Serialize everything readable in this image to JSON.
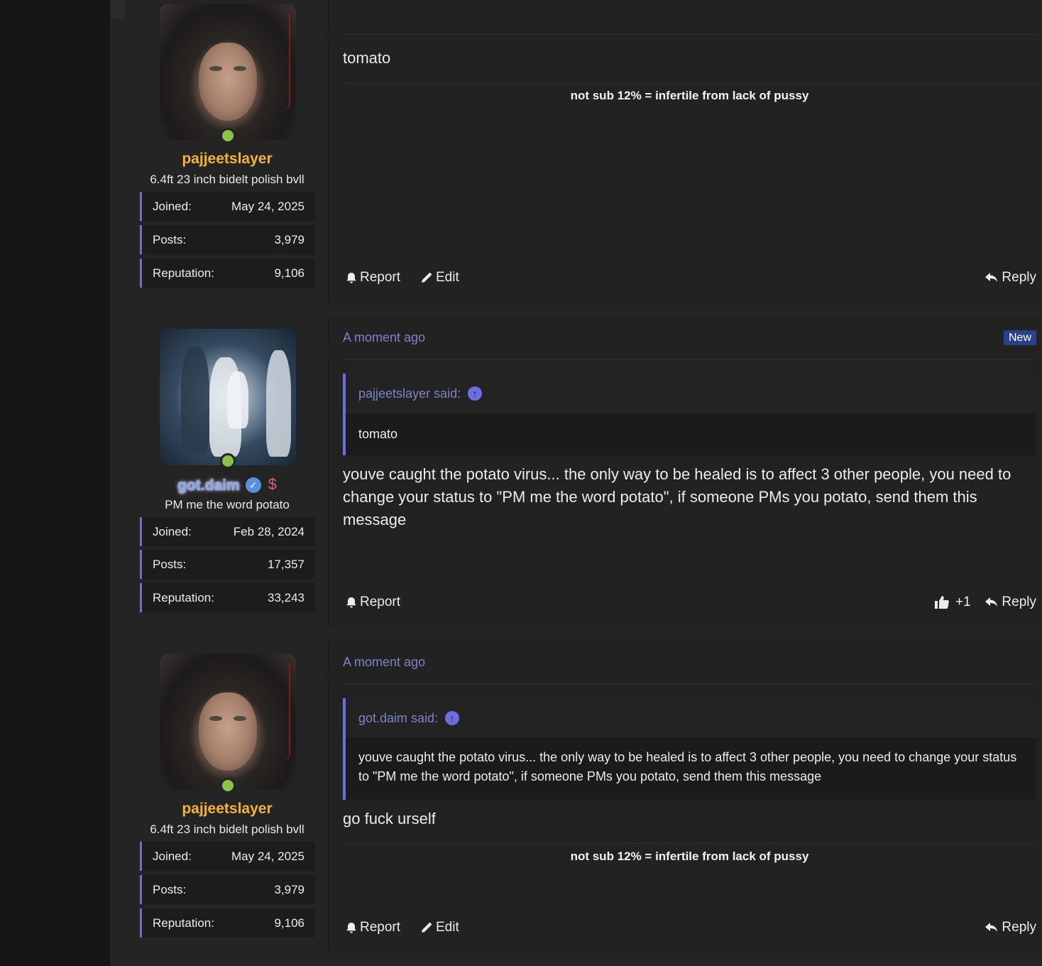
{
  "posts": [
    {
      "username": "pajjeetslayer",
      "user_title": "6.4ft 23 inch bidelt polish bvll",
      "stats": [
        {
          "label": "Joined:",
          "value": "May 24, 2025"
        },
        {
          "label": "Posts:",
          "value": "3,979"
        },
        {
          "label": "Reputation:",
          "value": "9,106"
        }
      ],
      "message": "tomato",
      "signature": "not sub 12% = infertile from lack of pussy",
      "actions": {
        "report": "Report",
        "edit": "Edit",
        "reply": "Reply"
      }
    },
    {
      "username": "got.daim",
      "user_title": "PM me the word potato",
      "stats": [
        {
          "label": "Joined:",
          "value": "Feb 28, 2024"
        },
        {
          "label": "Posts:",
          "value": "17,357"
        },
        {
          "label": "Reputation:",
          "value": "33,243"
        }
      ],
      "timestamp": "A moment ago",
      "badge": "New",
      "quote": {
        "author": "pajjeetslayer said:",
        "text": "tomato"
      },
      "message": "youve caught the potato virus... the only way to be healed is to affect 3 other people, you need to change your status to \"PM me the word potato\", if someone PMs you potato, send them this message",
      "actions": {
        "report": "Report",
        "like_count": "+1",
        "reply": "Reply"
      }
    },
    {
      "username": "pajjeetslayer",
      "user_title": "6.4ft 23 inch bidelt polish bvll",
      "stats": [
        {
          "label": "Joined:",
          "value": "May 24, 2025"
        },
        {
          "label": "Posts:",
          "value": "3,979"
        },
        {
          "label": "Reputation:",
          "value": "9,106"
        }
      ],
      "timestamp": "A moment ago",
      "quote": {
        "author": "got.daim said:",
        "text": "youve caught the potato virus... the only way to be healed is to affect 3 other people, you need to change your status to \"PM me the word potato\", if someone PMs you potato, send them this message"
      },
      "message": "go fuck urself",
      "signature": "not sub 12% = infertile from lack of pussy",
      "actions": {
        "report": "Report",
        "edit": "Edit",
        "reply": "Reply"
      }
    }
  ],
  "colors": {
    "username_gold": "#f2b33d",
    "username_glow": "#8aa2e8",
    "accent": "#6a6ee0",
    "online": "#8bc34a",
    "badge_new": "#2b3f8a",
    "timestamp": "#7d83c8"
  },
  "icons": [
    "bell-icon",
    "pencil-icon",
    "reply-icon",
    "thumbs-up-icon",
    "verified-check-icon",
    "dollar-icon",
    "arrow-up-circle-icon"
  ]
}
